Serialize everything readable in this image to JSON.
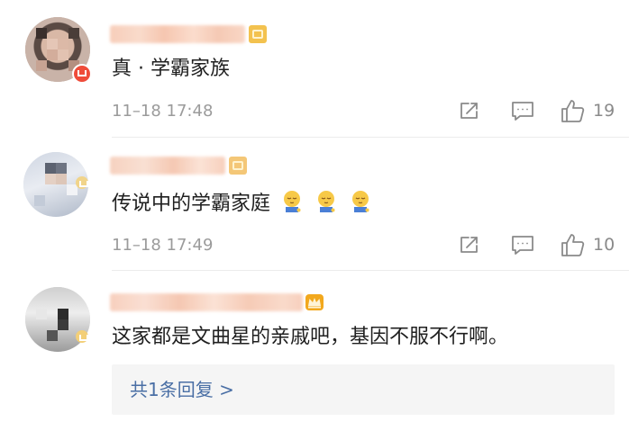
{
  "colors": {
    "link_blue": "#4a6fa5",
    "meta_gray": "#9b9b9b",
    "icon_gray": "#8a8a8a",
    "text_dark": "#1f1f1f",
    "divider": "#ececec"
  },
  "comments": [
    {
      "text": "真 · 学霸家族",
      "time": "11–18 17:48",
      "likes": "19",
      "icons": [
        "share-icon",
        "comment-icon",
        "like-icon"
      ]
    },
    {
      "text": "传说中的学霸家庭",
      "emoji_names": [
        "dozing-emoji",
        "dozing-emoji",
        "dozing-emoji"
      ],
      "time": "11–18 17:49",
      "likes": "10",
      "icons": [
        "share-icon",
        "comment-icon",
        "like-icon"
      ]
    },
    {
      "text": "这家都是文曲星的亲戚吧，基因不服不行啊。",
      "reply_link": "共1条回复 >"
    }
  ]
}
